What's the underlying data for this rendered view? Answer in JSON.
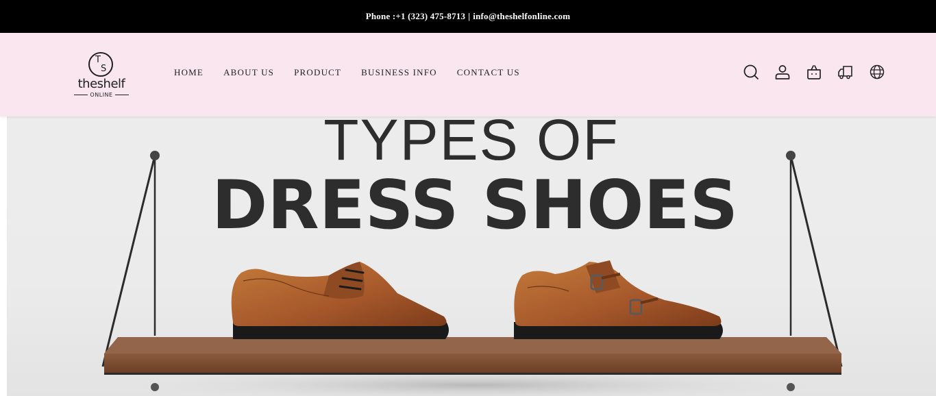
{
  "topbar": {
    "phone": "Phone :+1 (323) 475-8713",
    "separator": "|",
    "email": "info@theshelfonline.com"
  },
  "logo": {
    "monogram": "TS",
    "wordmark": "theshelf",
    "sub": "ONLINE"
  },
  "nav": {
    "items": [
      {
        "label": "HOME"
      },
      {
        "label": "ABOUT US"
      },
      {
        "label": "PRODUCT"
      },
      {
        "label": "BUSINESS INFO"
      },
      {
        "label": "CONTACT US"
      }
    ]
  },
  "header_icons": [
    "search-icon",
    "account-icon",
    "cart-icon",
    "shipping-icon",
    "language-globe-icon"
  ],
  "hero": {
    "title_light": "TYPES OF",
    "title_bold": "DRESS SHOES",
    "image": "two-brown-leather-dress-shoes-on-wooden-wall-shelf"
  },
  "colors": {
    "topbar_bg": "#000000",
    "header_bg": "#f9e6ef",
    "hero_bg": "#ececec",
    "shoe_brown": "#a85a2a",
    "shelf_wood": "#7a4a30"
  }
}
